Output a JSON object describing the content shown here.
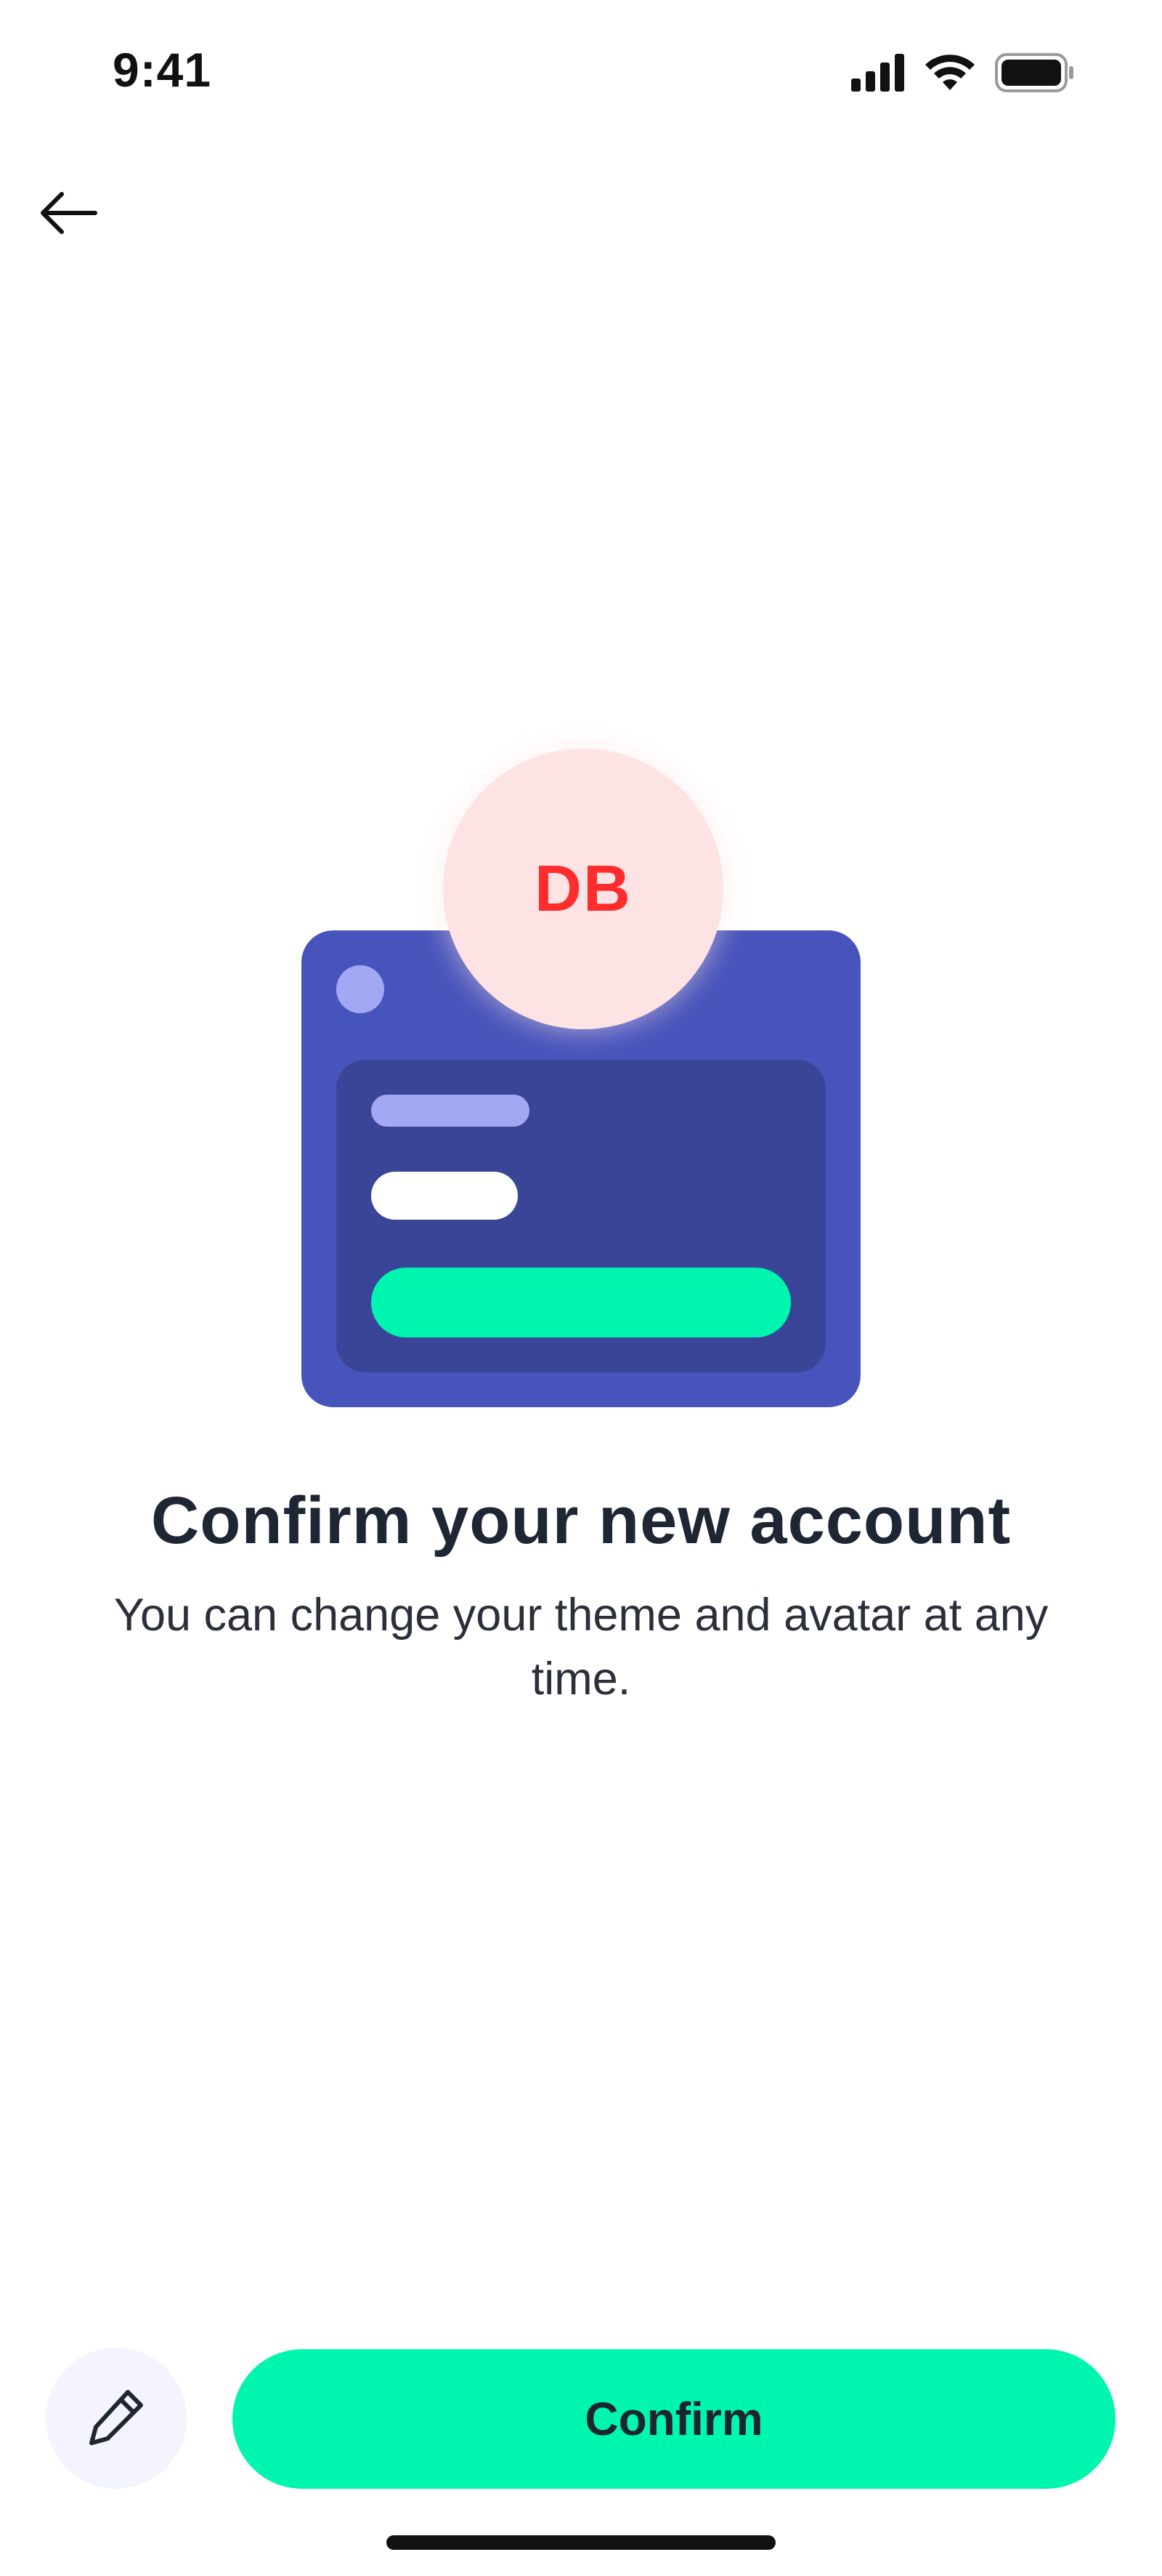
{
  "status_bar": {
    "time": "9:41",
    "icons": [
      "cellular-signal-icon",
      "wifi-icon",
      "battery-icon"
    ]
  },
  "navigation": {
    "back_icon": "arrow-left-icon"
  },
  "illustration": {
    "avatar_initials": "DB",
    "colors": {
      "card": "#4754bb",
      "panel": "#3a4597",
      "accent_light": "#a3a8f5",
      "accent_green": "#00f5af",
      "avatar_bg": "#fde3e3",
      "avatar_text": "#ff2d2d"
    }
  },
  "content": {
    "title": "Confirm your new account",
    "subtitle": "You can change your theme and avatar at any time."
  },
  "actions": {
    "edit_icon": "pencil-icon",
    "confirm_label": "Confirm",
    "confirm_color": "#00f5af"
  }
}
